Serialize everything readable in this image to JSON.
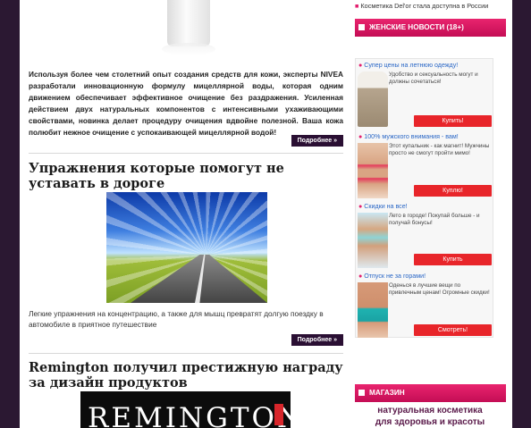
{
  "colors": {
    "accent": "#e31e6e",
    "button_dark": "#2a0f33",
    "ad_button": "#e8252a",
    "frame": "#2b1832"
  },
  "article1": {
    "intro": "Используя более чем столетний опыт создания средств для кожи, эксперты NIVEA разработали инновационную формулу мицеллярной воды, которая одним движением обеспечивает эффективное очищение без раздражения. Усиленная действием двух натуральных компонентов с интенсивными ухаживающими свойствами, новинка делает процедуру очищения вдвойне полезной. Ваша кожа полюбит нежное очищение с успокаивающей мицеллярной водой!",
    "more": "Подробнее »"
  },
  "article2": {
    "title": "Упражнения которые помогут не уставать в дороге",
    "desc": "Легкие упражнения на концентрацию, а также для мышц превратят долгую поездку в автомобиле в приятное путешествие",
    "more": "Подробнее »"
  },
  "article3": {
    "title": "Remington получил престижную награду за дизайн продуктов",
    "logo_text": "REMINGTON"
  },
  "sidebar": {
    "top_link": "Косметика Del'or стала доступна в России",
    "news_header": "ЖЕНСКИЕ НОВОСТИ (18+)",
    "shop_header": "МАГАЗИН",
    "shop_line1": "натуральная косметика",
    "shop_line2": "для здоровья и красоты",
    "ads": [
      {
        "title": "Супер цены на летнюю одежду!",
        "text": "Удобство и сексуальность могут и должны сочетаться!",
        "button": "Купить!"
      },
      {
        "title": "100% мужского внимания - вам!",
        "text": "Этот купальник - как магнит! Мужчины просто не смогут пройти мимо!",
        "button": "Куплю!"
      },
      {
        "title": "Скидки на все!",
        "text": "Лето в городе! Покупай больше - и получай бонусы!",
        "button": "Купить"
      },
      {
        "title": "Отпуск не за горами!",
        "text": "Оденься в лучшие вещи по привлечным ценам! Огромные скидки!",
        "button": "Смотреть!"
      }
    ]
  }
}
